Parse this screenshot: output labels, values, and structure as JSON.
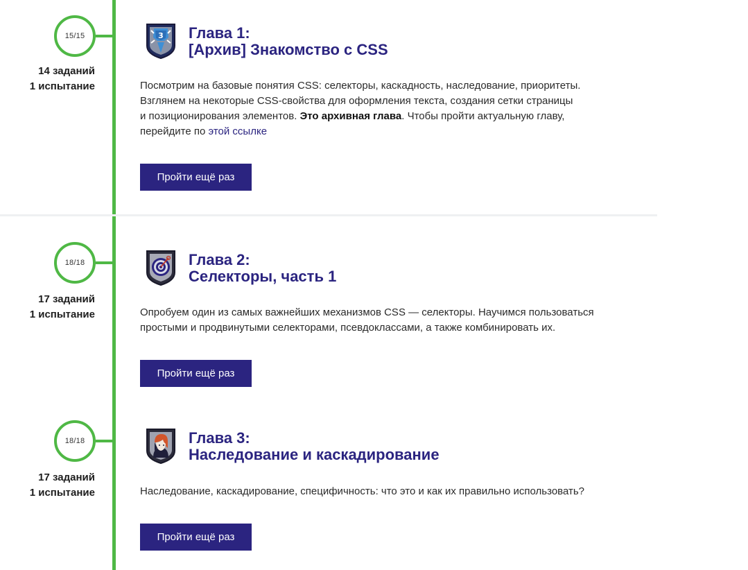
{
  "chapters": [
    {
      "progress": "15/15",
      "tasks": "14 заданий",
      "trials": "1 испытание",
      "title_line1": "Глава 1:",
      "title_line2": "[Архив] Знакомство с CSS",
      "badge_icon": "css3-shield-icon",
      "desc_part1": "Посмотрим на базовые понятия CSS: селекторы, каскадность, наследование, приоритеты.",
      "desc_part2": "Взглянем на некоторые CSS-свойства для оформления текста, создания сетки страницы",
      "desc_part3": "и позиционирования элементов.",
      "desc_bold": "Это архивная глава",
      "desc_part4": ". Чтобы пройти актуальную главу,",
      "desc_part5": "перейдите по",
      "desc_link": "этой ссылке",
      "button_label": "Пройти ещё раз"
    },
    {
      "progress": "18/18",
      "tasks": "17 заданий",
      "trials": "1 испытание",
      "title_line1": "Глава 2:",
      "title_line2": "Селекторы, часть 1",
      "badge_icon": "target-shield-icon",
      "desc_line1": "Опробуем один из самых важнейших механизмов CSS — селекторы. Научимся пользоваться",
      "desc_line2": "простыми и продвинутыми селекторами, псевдоклассами, а также комбинировать их.",
      "button_label": "Пройти ещё раз"
    },
    {
      "progress": "18/18",
      "tasks": "17 заданий",
      "trials": "1 испытание",
      "title_line1": "Глава 3:",
      "title_line2": "Наследование и каскадирование",
      "badge_icon": "portrait-shield-icon",
      "desc_line1": "Наследование, каскадирование, специфичность: что это и как их правильно использовать?",
      "button_label": "Пройти ещё раз"
    }
  ],
  "colors": {
    "timeline": "#4fb845",
    "accent": "#2b2480",
    "divider": "#eef0f2"
  }
}
